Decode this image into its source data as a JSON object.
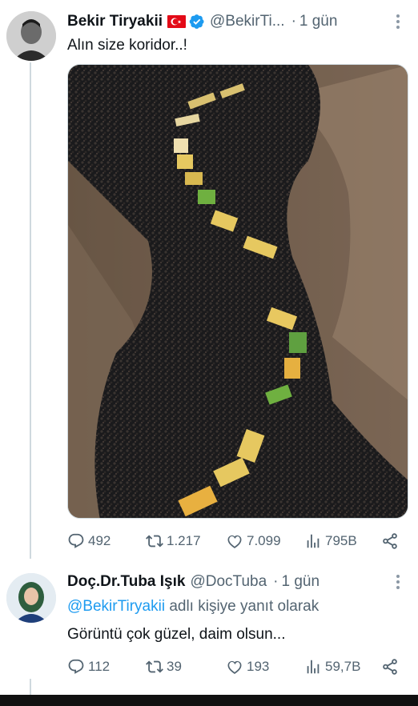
{
  "tweet1": {
    "name": "Bekir Tiryakii",
    "handle": "@BekirTi...",
    "time": "1 gün",
    "text": "Alın size koridor..!",
    "replies": "492",
    "retweets": "1.217",
    "likes": "7.099",
    "views": "795B"
  },
  "tweet2": {
    "name": "Doç.Dr.Tuba Işık",
    "handle": "@DocTuba",
    "time": "1 gün",
    "reply_handle": "@BekirTiryakii",
    "reply_suffix": " adlı kişiye yanıt olarak",
    "text": "Görüntü çok güzel, daim olsun...",
    "replies": "112",
    "retweets": "39",
    "likes": "193",
    "views": "59,7B"
  },
  "colors": {
    "accent": "#1d9bf0",
    "muted": "#536471",
    "flag": "#e30a17"
  },
  "icons": [
    "reply-icon",
    "retweet-icon",
    "like-icon",
    "views-icon",
    "share-icon",
    "verified-badge-icon",
    "more-options-icon"
  ]
}
